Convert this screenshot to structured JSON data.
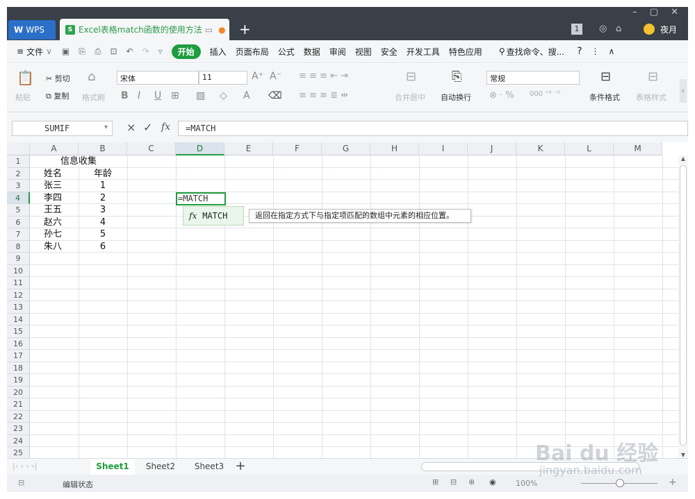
{
  "titlebar": {
    "app_tab": "WPS",
    "doc_title": "Excel表格match函数的使用方法",
    "plus": "+",
    "badge": "1",
    "user": "夜月"
  },
  "menu": {
    "hamburger": "≡",
    "file": "文件",
    "start": "开始",
    "items": [
      "插入",
      "页面布局",
      "公式",
      "数据",
      "审阅",
      "视图",
      "安全",
      "开发工具",
      "特色应用"
    ],
    "search": "查找命令、搜...",
    "help": "?",
    "more": "⋮",
    "collapse": "∧"
  },
  "ribbon": {
    "paste": "粘贴",
    "cut": "剪切",
    "copy": "复制",
    "format_painter": "格式刷",
    "font_name": "宋体",
    "font_size": "11",
    "merge_center": "合并居中",
    "wrap_text": "自动换行",
    "number_format": "常规",
    "conditional_format": "条件格式",
    "table_style": "表格样式"
  },
  "formula_bar": {
    "name_box": "SUMIF",
    "cancel": "×",
    "confirm": "✓",
    "fx": "fx",
    "formula": "=MATCH"
  },
  "grid": {
    "columns": [
      "A",
      "B",
      "C",
      "D",
      "E",
      "F",
      "G",
      "H",
      "I",
      "J",
      "K",
      "L",
      "M"
    ],
    "rows": [
      "1",
      "2",
      "3",
      "4",
      "5",
      "6",
      "7",
      "8",
      "9",
      "10",
      "11",
      "12",
      "13",
      "14",
      "15",
      "16",
      "17",
      "18",
      "19",
      "20",
      "21",
      "22",
      "23",
      "24",
      "25"
    ],
    "active_col": "D",
    "active_row": "4",
    "cells": {
      "A1": "信息收集",
      "A2": "姓名",
      "B2": "年龄",
      "A3": "张三",
      "B3": "1",
      "A4": "李四",
      "B4": "2",
      "A5": "王五",
      "B5": "3",
      "A6": "赵六",
      "B6": "4",
      "A7": "孙七",
      "B7": "5",
      "A8": "朱八",
      "B8": "6"
    },
    "active_cell_value": "=MATCH"
  },
  "autocomplete": {
    "fx": "fx",
    "function": "MATCH",
    "tooltip": "返回在指定方式下与指定项匹配的数组中元素的相应位置。"
  },
  "sheets": {
    "tabs": [
      "Sheet1",
      "Sheet2",
      "Sheet3"
    ],
    "active": "Sheet1",
    "add": "+"
  },
  "status": {
    "mode": "编辑状态",
    "zoom": "100%"
  },
  "watermark": {
    "brand": "Bai du 经验",
    "url": "jingyan.baidu.com"
  },
  "colors": {
    "accent": "#1f9c3f",
    "titlebar": "#3a4047",
    "wps_blue": "#2b6fc8"
  }
}
